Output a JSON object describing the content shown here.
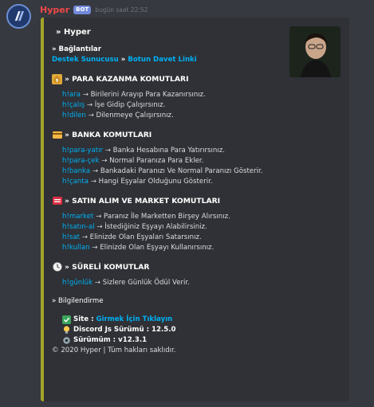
{
  "message": {
    "username": "Hyper",
    "bot_tag": "BOT",
    "timestamp": "bugün saat 22:52"
  },
  "embed": {
    "accent_color": "#a3a32a",
    "title": "» Hyper",
    "links_heading": "» Bağlantılar",
    "links": {
      "support": "Destek Sunucusu",
      "separator": " » ",
      "invite": "Botun Davet Linki"
    },
    "sections": [
      {
        "icon": "money-bag-icon",
        "heading": "» PARA KAZANMA KOMUTLARI",
        "commands": [
          {
            "cmd": "h!ara",
            "desc": " → Birilerini Arayıp Para Kazanırsınız."
          },
          {
            "cmd": "h!çalış",
            "desc": " → İşe Gidip Çalışırsınız."
          },
          {
            "cmd": "h!dilen",
            "desc": " → Dilenmeye Çalışırsınız."
          }
        ]
      },
      {
        "icon": "credit-card-icon",
        "heading": "» BANKA KOMUTLARI",
        "commands": [
          {
            "cmd": "h!para-yatır",
            "desc": " → Banka Hesabına Para Yatırırsınız."
          },
          {
            "cmd": "h!para-çek",
            "desc": " → Normal Paranıza Para Ekler."
          },
          {
            "cmd": "h!banka",
            "desc": " → Bankadaki Paranızı Ve Normal Paranızı Gösterir."
          },
          {
            "cmd": "h!çanta",
            "desc": " → Hangi Eşyalar Olduğunu Gösterir."
          }
        ]
      },
      {
        "icon": "cart-icon",
        "heading": "» SATIN ALIM VE MARKET KOMUTLARI",
        "commands": [
          {
            "cmd": "h!market",
            "desc": " → Paranız İle Marketten Birşey Alırsınız."
          },
          {
            "cmd": "h!satın-al",
            "desc": " → İstediğiniz Eşyayı Alabilirsiniz."
          },
          {
            "cmd": "h!sat",
            "desc": " → Elinizde Olan Eşyaları Satarsınız."
          },
          {
            "cmd": "h!kullan",
            "desc": " → Elinizde Olan Eşyayı Kullanırsınız."
          }
        ]
      },
      {
        "icon": "clock-icon",
        "heading": "» SÜRELİ KOMUTLAR",
        "commands": [
          {
            "cmd": "h!günlük",
            "desc": " → Sizlere Günlük Ödül Verir."
          }
        ]
      }
    ],
    "info_heading": "» Bilgilendirme",
    "info": {
      "site_label": "Site : ",
      "site_link": "Girmek İçin Tıklayın",
      "discord_label": "Discord Js Sürümü : 12.5.0",
      "version_label": "Sürümüm : v12.3.1"
    },
    "footer": "© 2020 Hyper | Tüm hakları saklıdır."
  }
}
